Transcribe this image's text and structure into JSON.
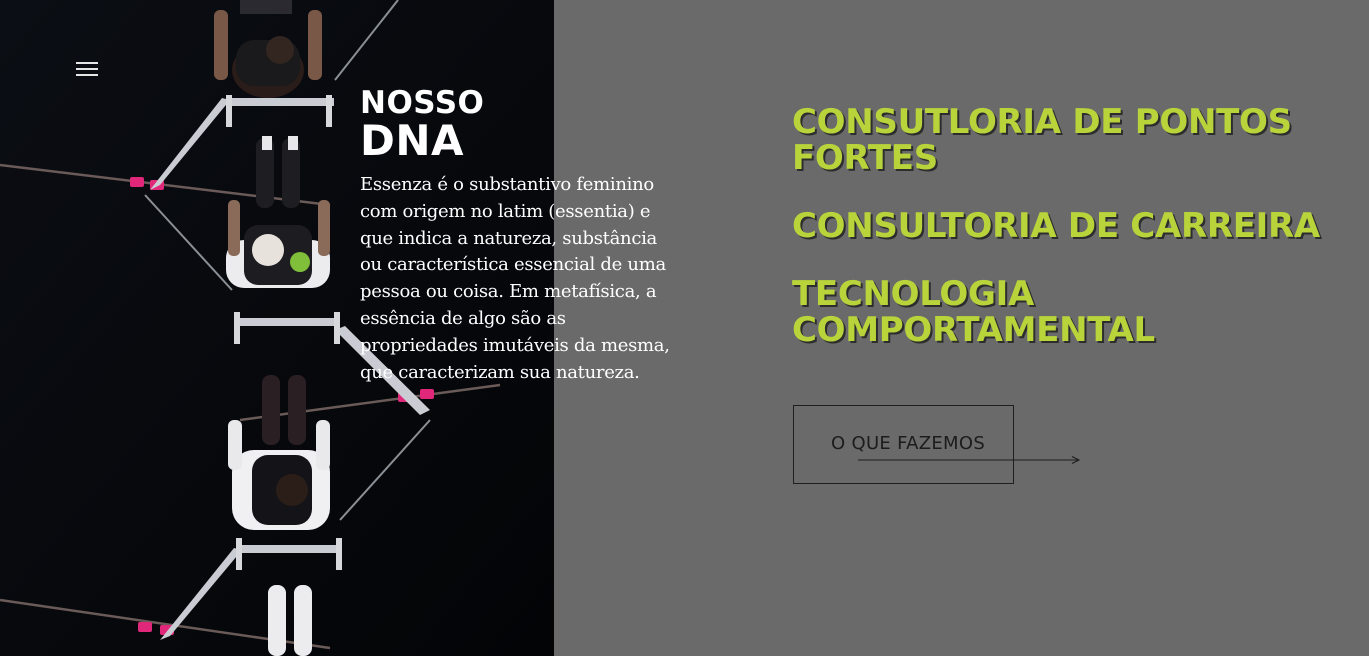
{
  "menu": {
    "icon": "hamburger-menu-icon"
  },
  "dna": {
    "heading_line1": "NOSSO",
    "heading_line2": "DNA",
    "body": "Essenza é o substantivo feminino com origem no latim (essentia) e que indica a natureza, substância ou característica essencial de uma pessoa ou coisa. Em metafísica, a essência de algo são as propriedades imutáveis da mesma, que caracterizam sua natureza."
  },
  "services": [
    {
      "line1": "CONSUTLORIA DE PONTOS",
      "line2": "FORTES"
    },
    {
      "line1": "CONSULTORIA DE CARREIRA",
      "line2": ""
    },
    {
      "line1": "TECNOLOGIA",
      "line2": "COMPORTAMENTAL"
    }
  ],
  "cta": {
    "label": "O QUE FAZEMOS",
    "icon": "arrow-right-icon"
  },
  "colors": {
    "accent": "#b9d33b",
    "grey_panel": "#6a6a6b",
    "dark_panel": "#050608"
  }
}
